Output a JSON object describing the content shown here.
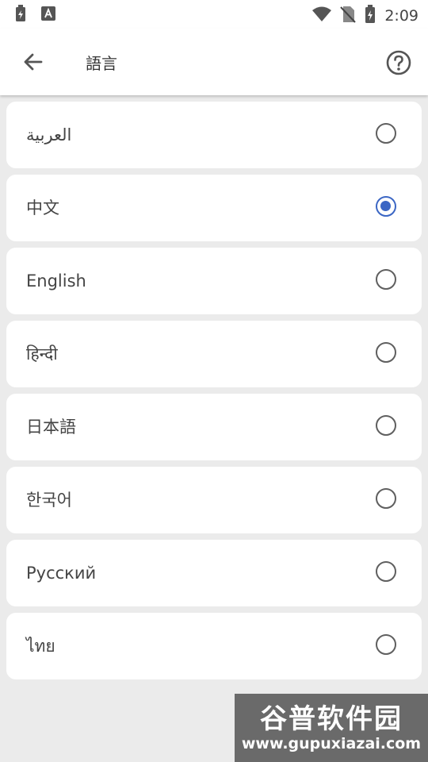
{
  "status_bar": {
    "time": "2:09",
    "left_icons": [
      "battery-saver-icon",
      "app-notification-icon"
    ],
    "right_icons": [
      "wifi-icon",
      "no-sim-icon",
      "battery-charging-icon"
    ]
  },
  "app_bar": {
    "title": "語言",
    "back_icon": "arrow-back-icon",
    "help_icon": "help-circle-icon"
  },
  "languages": [
    {
      "label": "العربية",
      "selected": false
    },
    {
      "label": "中文",
      "selected": true
    },
    {
      "label": "English",
      "selected": false
    },
    {
      "label": "हिन्दी",
      "selected": false
    },
    {
      "label": "日本語",
      "selected": false
    },
    {
      "label": "한국어",
      "selected": false
    },
    {
      "label": "Русский",
      "selected": false
    },
    {
      "label": "ไทย",
      "selected": false
    }
  ],
  "watermark": {
    "title": "谷普软件园",
    "url": "www.gupuxiazai.com"
  },
  "colors": {
    "accent": "#3b66c4",
    "background": "#ebebeb",
    "card": "#ffffff"
  }
}
